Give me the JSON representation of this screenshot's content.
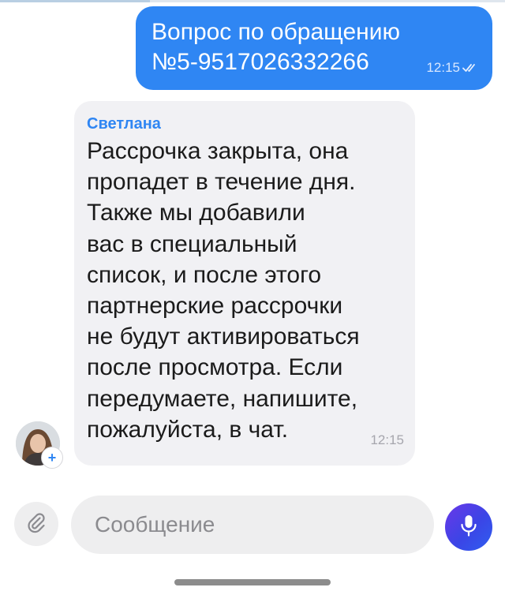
{
  "colors": {
    "accent": "#2f86f3",
    "outgoing_bubble": "#2f86f3",
    "incoming_bubble": "#f1f1f4",
    "mic_gradient_start": "#6a38e8",
    "mic_gradient_end": "#2f5ef0"
  },
  "messages": [
    {
      "direction": "outgoing",
      "lines": [
        "Вопрос по обращению",
        "№5-9517026332266"
      ],
      "time": "12:15",
      "status_icon": "double-check-icon"
    },
    {
      "direction": "incoming",
      "sender": "Светлана",
      "lines": [
        "Рассрочка закрыта, она",
        "пропадет в течение дня.",
        "Также мы добавили",
        "вас в специальный",
        "список, и после этого",
        "партнерские рассрочки",
        "не будут активироваться",
        "после просмотра. Если",
        "передумаете, напишите,",
        "пожалуйста, в чат."
      ],
      "time": "12:15"
    }
  ],
  "avatar": {
    "badge": "+"
  },
  "composer": {
    "placeholder": "Сообщение",
    "attach_icon": "paperclip-icon",
    "send_icon": "microphone-icon"
  }
}
